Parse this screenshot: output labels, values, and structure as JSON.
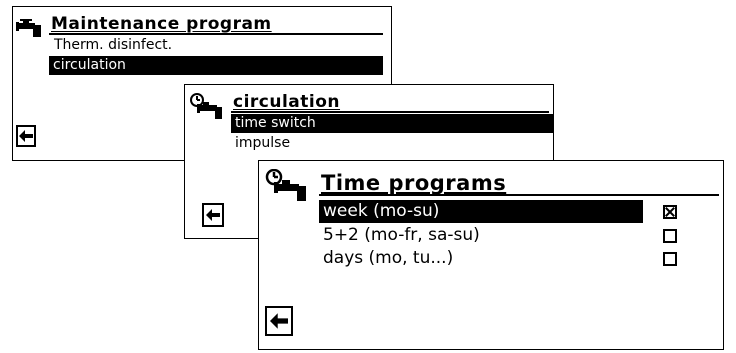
{
  "screen1": {
    "title": "Maintenance program",
    "items": [
      "Therm. disinfect.",
      "circulation"
    ],
    "selected_index": 1,
    "icon": "faucet-icon"
  },
  "screen2": {
    "title": "circulation",
    "items": [
      "time switch",
      "impulse"
    ],
    "selected_index": 0,
    "icon": "clock-faucet-icon"
  },
  "screen3": {
    "title": "Time programs",
    "options": [
      {
        "label": "week (mo-su)",
        "checked": true
      },
      {
        "label": "5+2 (mo-fr, sa-su)",
        "checked": false
      },
      {
        "label": "days (mo, tu...)",
        "checked": false
      }
    ],
    "selected_index": 0,
    "icon": "clock-faucet-icon"
  },
  "back_icon": "arrow-left-icon"
}
